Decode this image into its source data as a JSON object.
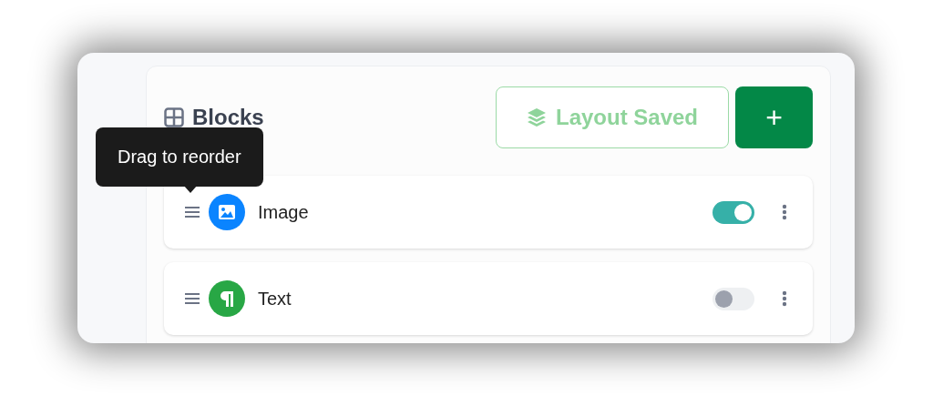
{
  "panel": {
    "title": "Blocks"
  },
  "status_button": {
    "label": "Layout Saved"
  },
  "add_button": {
    "label": "+"
  },
  "tooltip": {
    "text": "Drag to reorder"
  },
  "blocks": [
    {
      "kind": "image",
      "label": "Image",
      "color": "#0a84ff",
      "on": true
    },
    {
      "kind": "text",
      "label": "Text",
      "color": "#28a745",
      "on": false
    }
  ]
}
